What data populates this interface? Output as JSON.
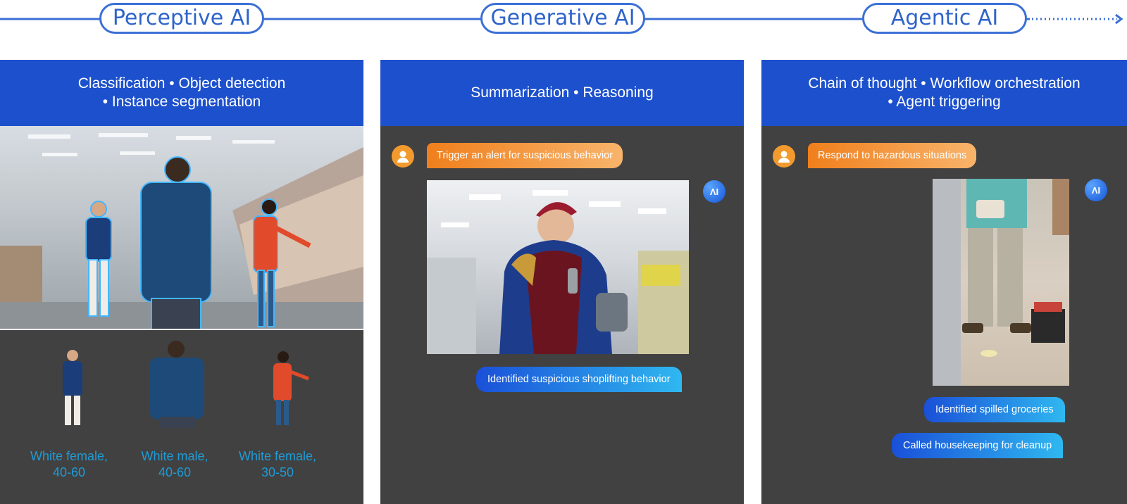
{
  "timeline": {
    "stages": [
      "Perceptive AI",
      "Generative AI",
      "Agentic AI"
    ]
  },
  "panels": [
    {
      "header_line1": "Classification • Object detection",
      "header_line2": "• Instance segmentation",
      "detections": [
        {
          "label_line1": "White female,",
          "label_line2": "40-60"
        },
        {
          "label_line1": "White male,",
          "label_line2": "40-60"
        },
        {
          "label_line1": "White female,",
          "label_line2": "30-50"
        }
      ]
    },
    {
      "header_line1": "Summarization • Reasoning",
      "user_prompt": "Trigger an alert for suspicious behavior",
      "ai_badge": "ΛI",
      "ai_response": "Identified suspicious shoplifting behavior"
    },
    {
      "header_line1": "Chain of thought • Workflow orchestration",
      "header_line2": "• Agent triggering",
      "user_prompt": "Respond to hazardous situations",
      "ai_badge": "ΛI",
      "ai_responses": [
        "Identified spilled groceries",
        "Called housekeeping for cleanup"
      ]
    }
  ],
  "colors": {
    "accent_blue": "#1c50cc",
    "timeline_blue": "#3b6fd6",
    "panel_bg": "#414141",
    "user_orange": "#f29a2e",
    "label_teal": "#1f9bd6"
  }
}
